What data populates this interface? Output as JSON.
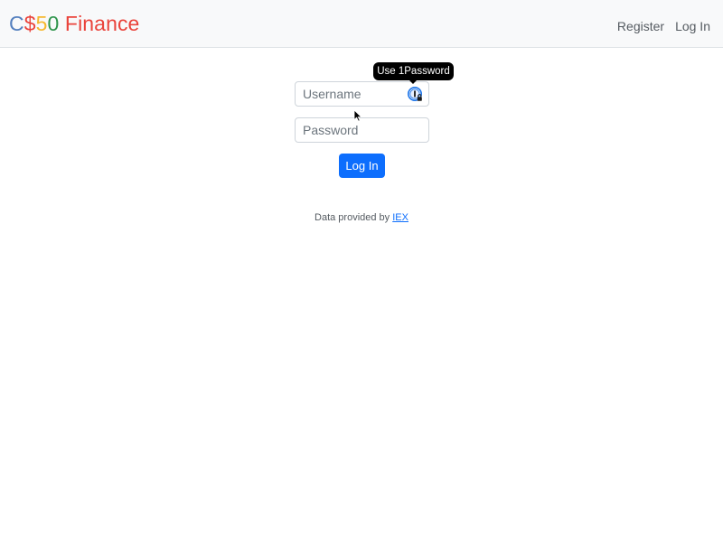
{
  "navbar": {
    "brand": {
      "c": "C",
      "dollar": "$",
      "five": "5",
      "zero": "0",
      "finance": " Finance"
    },
    "links": {
      "register": "Register",
      "login": "Log In"
    }
  },
  "form": {
    "username": {
      "placeholder": "Username",
      "value": ""
    },
    "password": {
      "placeholder": "Password",
      "value": ""
    },
    "submit_label": "Log In"
  },
  "tooltip": {
    "text": "Use 1Password",
    "icon": "onepassword-icon"
  },
  "footer": {
    "prefix": "Data provided by ",
    "link_text": "IEX"
  },
  "colors": {
    "brand_blue": "#537fbe",
    "brand_red": "#ea433b",
    "brand_yellow": "#f5b82e",
    "brand_green": "#2e944b",
    "primary_button": "#0d6efd",
    "navbar_bg": "#f8f9fa"
  }
}
